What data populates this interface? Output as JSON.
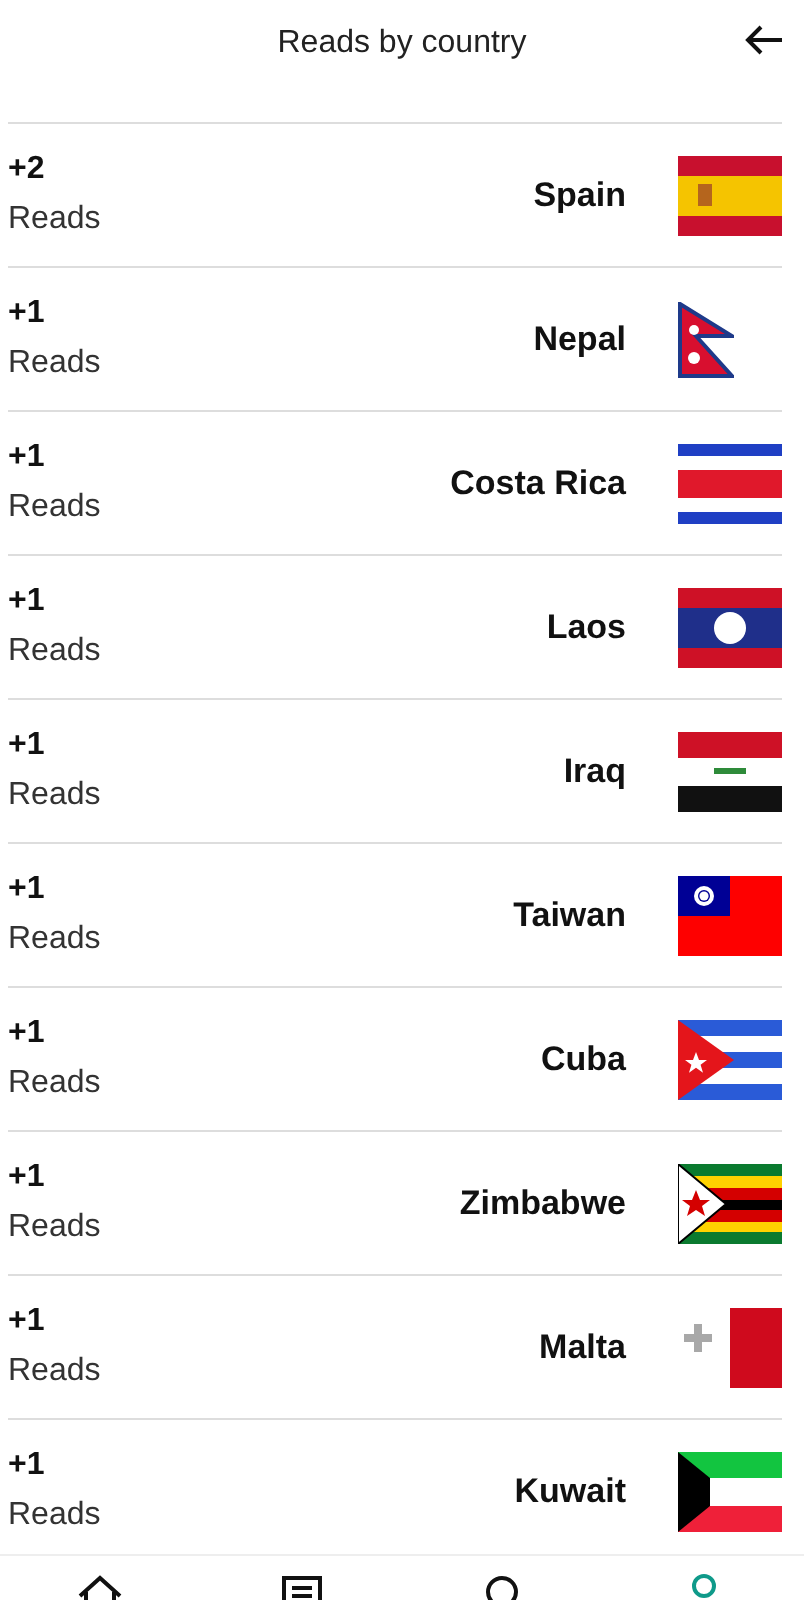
{
  "header": {
    "title": "Reads by country"
  },
  "rows": [
    {
      "count": "+2",
      "label": "Reads",
      "country": "Spain"
    },
    {
      "count": "+1",
      "label": "Reads",
      "country": "Nepal"
    },
    {
      "count": "+1",
      "label": "Reads",
      "country": "Costa Rica"
    },
    {
      "count": "+1",
      "label": "Reads",
      "country": "Laos"
    },
    {
      "count": "+1",
      "label": "Reads",
      "country": "Iraq"
    },
    {
      "count": "+1",
      "label": "Reads",
      "country": "Taiwan"
    },
    {
      "count": "+1",
      "label": "Reads",
      "country": "Cuba"
    },
    {
      "count": "+1",
      "label": "Reads",
      "country": "Zimbabwe"
    },
    {
      "count": "+1",
      "label": "Reads",
      "country": "Malta"
    },
    {
      "count": "+1",
      "label": "Reads",
      "country": "Kuwait"
    }
  ],
  "nav": [
    {
      "selected": false
    },
    {
      "selected": false
    },
    {
      "selected": false
    },
    {
      "selected": true
    }
  ]
}
